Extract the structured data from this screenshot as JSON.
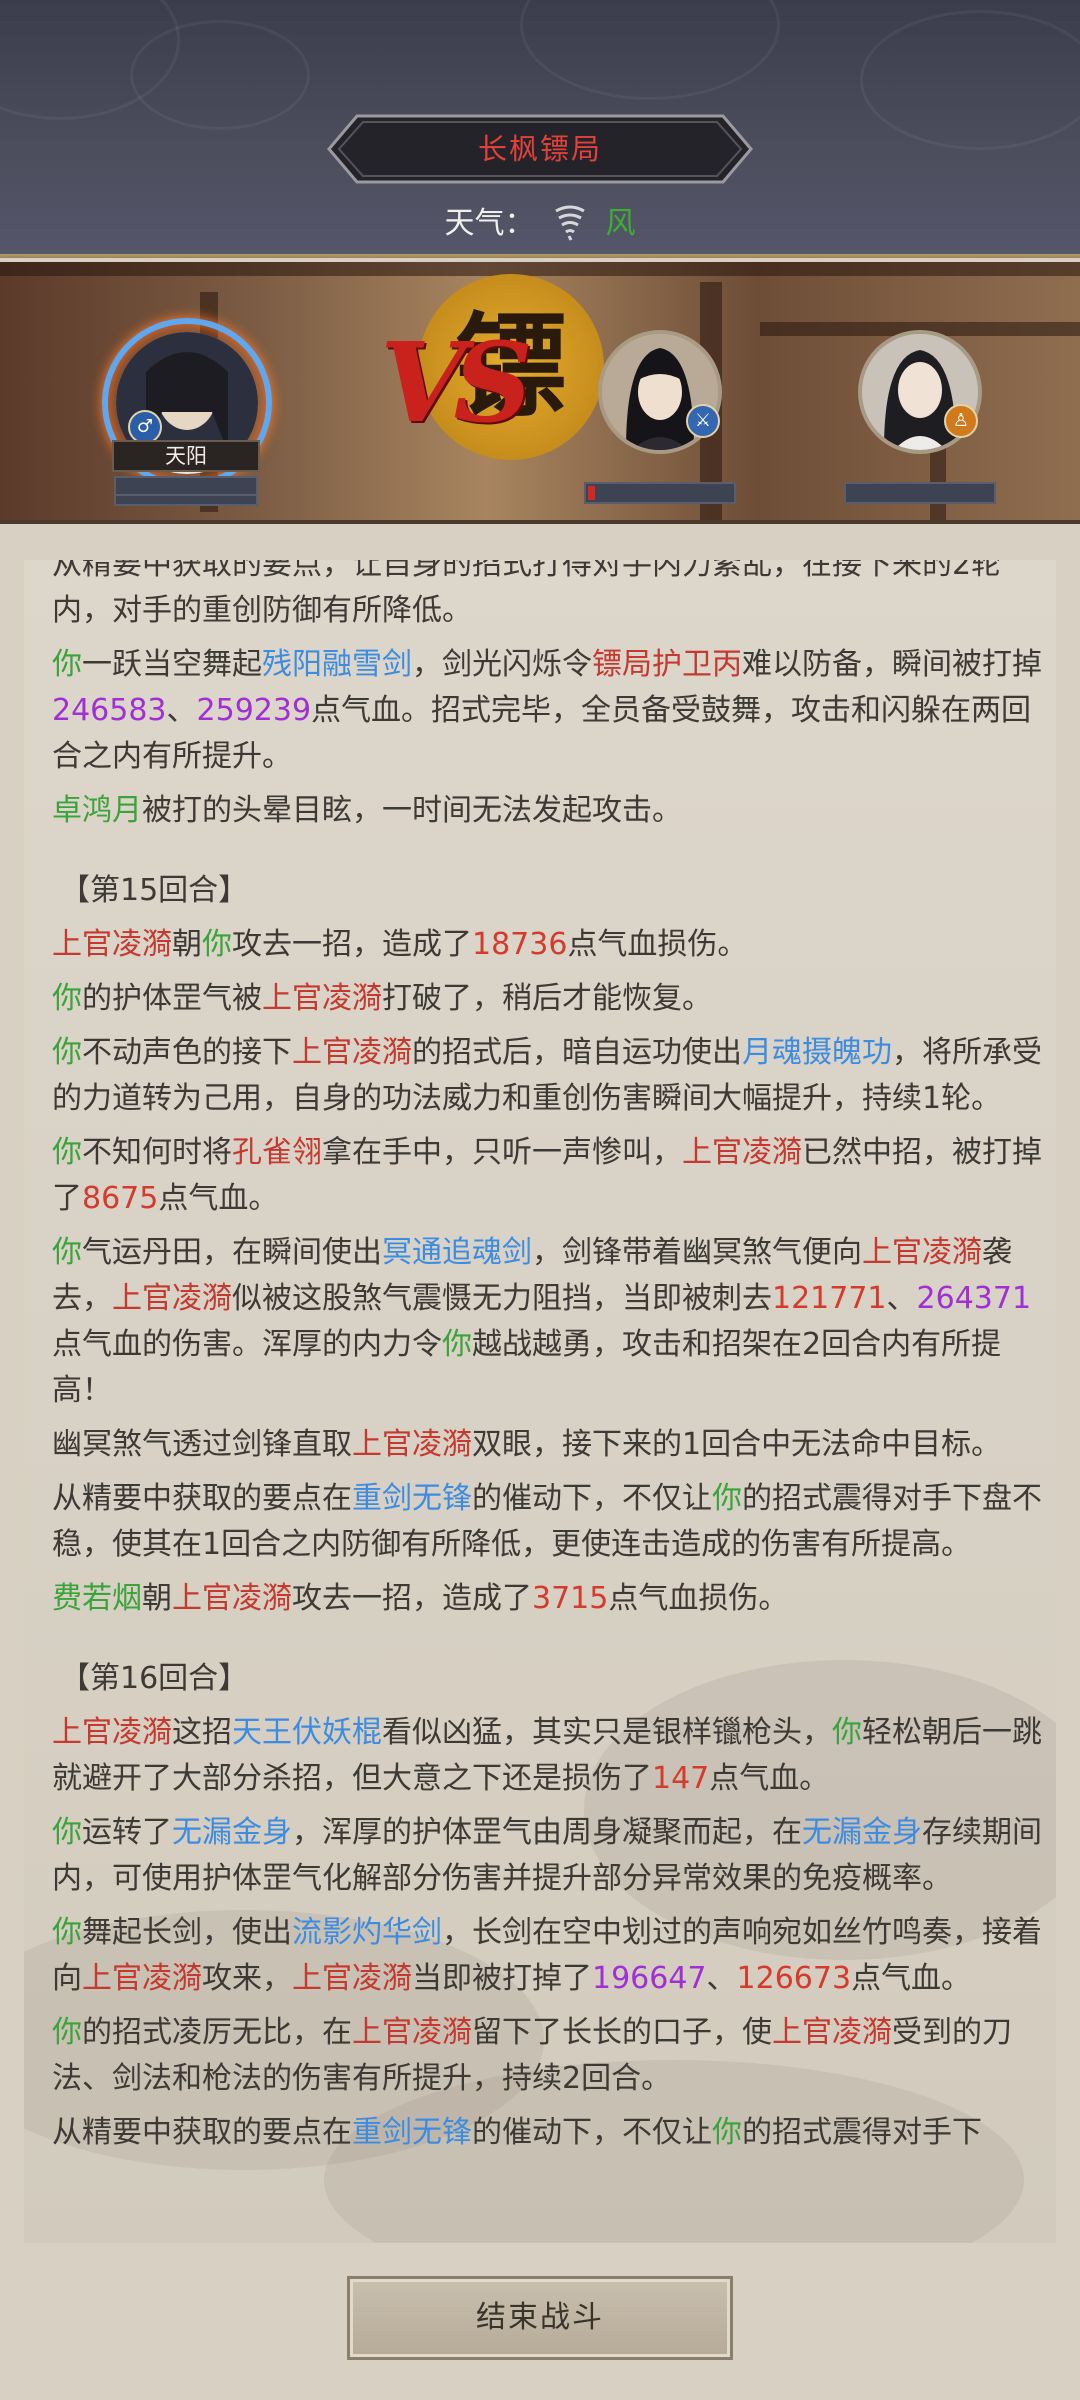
{
  "header": {
    "title": "长枫镖局",
    "weather_label": "天气：",
    "weather_value": "风"
  },
  "battle": {
    "player_name": "天阳",
    "vs_text": "VS",
    "seal_text": "镖",
    "enemy_hp": 0.05,
    "badges": [
      "♂",
      "⚔",
      "♙"
    ]
  },
  "log": [
    {
      "type": "text",
      "parts": [
        [
          "n",
          "从精要中获取的要点，让自身的招式打得对手内力紊乱，在接下来的2轮内，对手的重创防御有所降低。"
        ]
      ]
    },
    {
      "type": "text",
      "parts": [
        [
          "you",
          "你"
        ],
        [
          "n",
          "一跃当空舞起"
        ],
        [
          "skill",
          "残阳融雪剑"
        ],
        [
          "n",
          "，剑光闪烁令"
        ],
        [
          "enemy",
          "镖局护卫丙"
        ],
        [
          "n",
          "难以防备，瞬间被打掉"
        ],
        [
          "num",
          "246583"
        ],
        [
          "n",
          "、"
        ],
        [
          "num",
          "259239"
        ],
        [
          "n",
          "点气血。招式完毕，全员备受鼓舞，攻击和闪躲在两回合之内有所提升。"
        ]
      ]
    },
    {
      "type": "text",
      "parts": [
        [
          "ally",
          "卓鸿月"
        ],
        [
          "n",
          "被打的头晕目眩，一时间无法发起攻击。"
        ]
      ]
    },
    {
      "type": "round",
      "parts": [
        [
          "n",
          "【第15回合】"
        ]
      ]
    },
    {
      "type": "text",
      "parts": [
        [
          "enemy",
          "上官凌漪"
        ],
        [
          "n",
          "朝"
        ],
        [
          "you",
          "你"
        ],
        [
          "n",
          "攻去一招，造成了"
        ],
        [
          "dmg",
          "18736"
        ],
        [
          "n",
          "点气血损伤。"
        ]
      ]
    },
    {
      "type": "text",
      "parts": [
        [
          "you",
          "你"
        ],
        [
          "n",
          "的护体罡气被"
        ],
        [
          "enemy",
          "上官凌漪"
        ],
        [
          "n",
          "打破了，稍后才能恢复。"
        ]
      ]
    },
    {
      "type": "text",
      "parts": [
        [
          "you",
          "你"
        ],
        [
          "n",
          "不动声色的接下"
        ],
        [
          "enemy",
          "上官凌漪"
        ],
        [
          "n",
          "的招式后，暗自运功使出"
        ],
        [
          "skill",
          "月魂摄魄功"
        ],
        [
          "n",
          "，将所承受的力道转为己用，自身的功法威力和重创伤害瞬间大幅提升，持续1轮。"
        ]
      ]
    },
    {
      "type": "text",
      "parts": [
        [
          "you",
          "你"
        ],
        [
          "n",
          "不知何时将"
        ],
        [
          "enemy",
          "孔雀翎"
        ],
        [
          "n",
          "拿在手中，只听一声惨叫，"
        ],
        [
          "enemy",
          "上官凌漪"
        ],
        [
          "n",
          "已然中招，被打掉了"
        ],
        [
          "dmg",
          "8675"
        ],
        [
          "n",
          "点气血。"
        ]
      ]
    },
    {
      "type": "text",
      "parts": [
        [
          "you",
          "你"
        ],
        [
          "n",
          "气运丹田，在瞬间使出"
        ],
        [
          "skill",
          "冥通追魂剑"
        ],
        [
          "n",
          "，剑锋带着幽冥煞气便向"
        ],
        [
          "enemy",
          "上官凌漪"
        ],
        [
          "n",
          "袭去，"
        ],
        [
          "enemy",
          "上官凌漪"
        ],
        [
          "n",
          "似被这股煞气震慑无力阻挡，当即被刺去"
        ],
        [
          "dmg",
          "121771"
        ],
        [
          "n",
          "、"
        ],
        [
          "num",
          "264371"
        ],
        [
          "n",
          "点气血的伤害。浑厚的内力令"
        ],
        [
          "you",
          "你"
        ],
        [
          "n",
          "越战越勇，攻击和招架在2回合内有所提高！"
        ]
      ]
    },
    {
      "type": "text",
      "parts": [
        [
          "n",
          "幽冥煞气透过剑锋直取"
        ],
        [
          "enemy",
          "上官凌漪"
        ],
        [
          "n",
          "双眼，接下来的1回合中无法命中目标。"
        ]
      ]
    },
    {
      "type": "text",
      "parts": [
        [
          "n",
          "从精要中获取的要点在"
        ],
        [
          "skill",
          "重剑无锋"
        ],
        [
          "n",
          "的催动下，不仅让"
        ],
        [
          "you",
          "你"
        ],
        [
          "n",
          "的招式震得对手下盘不稳，使其在1回合之内防御有所降低，更使连击造成的伤害有所提高。"
        ]
      ]
    },
    {
      "type": "text",
      "parts": [
        [
          "ally",
          "费若烟"
        ],
        [
          "n",
          "朝"
        ],
        [
          "enemy",
          "上官凌漪"
        ],
        [
          "n",
          "攻去一招，造成了"
        ],
        [
          "dmg",
          "3715"
        ],
        [
          "n",
          "点气血损伤。"
        ]
      ]
    },
    {
      "type": "round",
      "parts": [
        [
          "n",
          "【第16回合】"
        ]
      ]
    },
    {
      "type": "text",
      "parts": [
        [
          "enemy",
          "上官凌漪"
        ],
        [
          "n",
          "这招"
        ],
        [
          "skill",
          "天王伏妖棍"
        ],
        [
          "n",
          "看似凶猛，其实只是银样镴枪头，"
        ],
        [
          "you",
          "你"
        ],
        [
          "n",
          "轻松朝后一跳就避开了大部分杀招，但大意之下还是损伤了"
        ],
        [
          "dmg",
          "147"
        ],
        [
          "n",
          "点气血。"
        ]
      ]
    },
    {
      "type": "text",
      "parts": [
        [
          "you",
          "你"
        ],
        [
          "n",
          "运转了"
        ],
        [
          "skill",
          "无漏金身"
        ],
        [
          "n",
          "，浑厚的护体罡气由周身凝聚而起，在"
        ],
        [
          "skill",
          "无漏金身"
        ],
        [
          "n",
          "存续期间内，可使用护体罡气化解部分伤害并提升部分异常效果的免疫概率。"
        ]
      ]
    },
    {
      "type": "text",
      "parts": [
        [
          "you",
          "你"
        ],
        [
          "n",
          "舞起长剑，使出"
        ],
        [
          "skill",
          "流影灼华剑"
        ],
        [
          "n",
          "，长剑在空中划过的声响宛如丝竹鸣奏，接着向"
        ],
        [
          "enemy",
          "上官凌漪"
        ],
        [
          "n",
          "攻来，"
        ],
        [
          "enemy",
          "上官凌漪"
        ],
        [
          "n",
          "当即被打掉了"
        ],
        [
          "num",
          "196647"
        ],
        [
          "n",
          "、"
        ],
        [
          "dmg",
          "126673"
        ],
        [
          "n",
          "点气血。"
        ]
      ]
    },
    {
      "type": "text",
      "parts": [
        [
          "you",
          "你"
        ],
        [
          "n",
          "的招式凌厉无比，在"
        ],
        [
          "enemy",
          "上官凌漪"
        ],
        [
          "n",
          "留下了长长的口子，使"
        ],
        [
          "enemy",
          "上官凌漪"
        ],
        [
          "n",
          "受到的刀法、剑法和枪法的伤害有所提升，持续2回合。"
        ]
      ]
    },
    {
      "type": "text",
      "parts": [
        [
          "n",
          "从精要中获取的要点在"
        ],
        [
          "skill",
          "重剑无锋"
        ],
        [
          "n",
          "的催动下，不仅让"
        ],
        [
          "you",
          "你"
        ],
        [
          "n",
          "的招式震得对手下"
        ]
      ]
    }
  ],
  "footer": {
    "end_button": "结束战斗"
  }
}
